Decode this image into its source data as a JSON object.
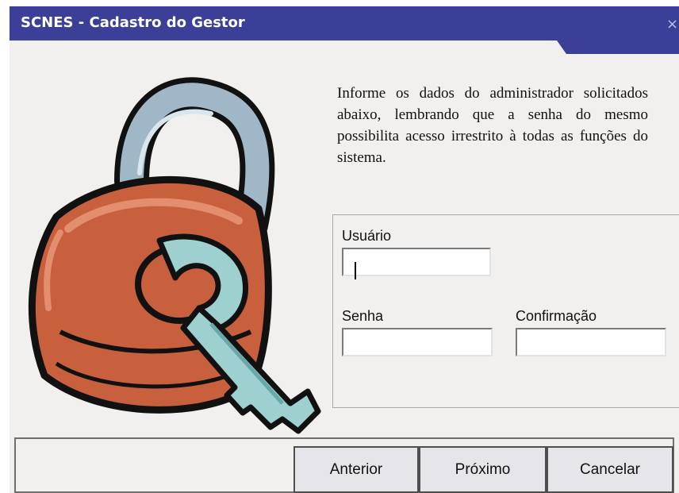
{
  "window": {
    "title": "SCNES - Cadastro do Gestor",
    "close_glyph": "×",
    "title_color": "#3c3f97"
  },
  "info_text": "Informe os dados do administrador solicitados abaixo, lembrando que a senha do mesmo possibilita acesso irrestrito à todas as funções do sistema.",
  "form": {
    "usuario_label": "Usuário",
    "usuario_value": "",
    "senha_label": "Senha",
    "senha_value": "",
    "confirmacao_label": "Confirmação",
    "confirmacao_value": ""
  },
  "buttons": {
    "anterior": "Anterior",
    "proximo": "Próximo",
    "cancelar": "Cancelar"
  },
  "icons": {
    "illustration": "padlock-with-key-icon",
    "close": "close-icon"
  }
}
